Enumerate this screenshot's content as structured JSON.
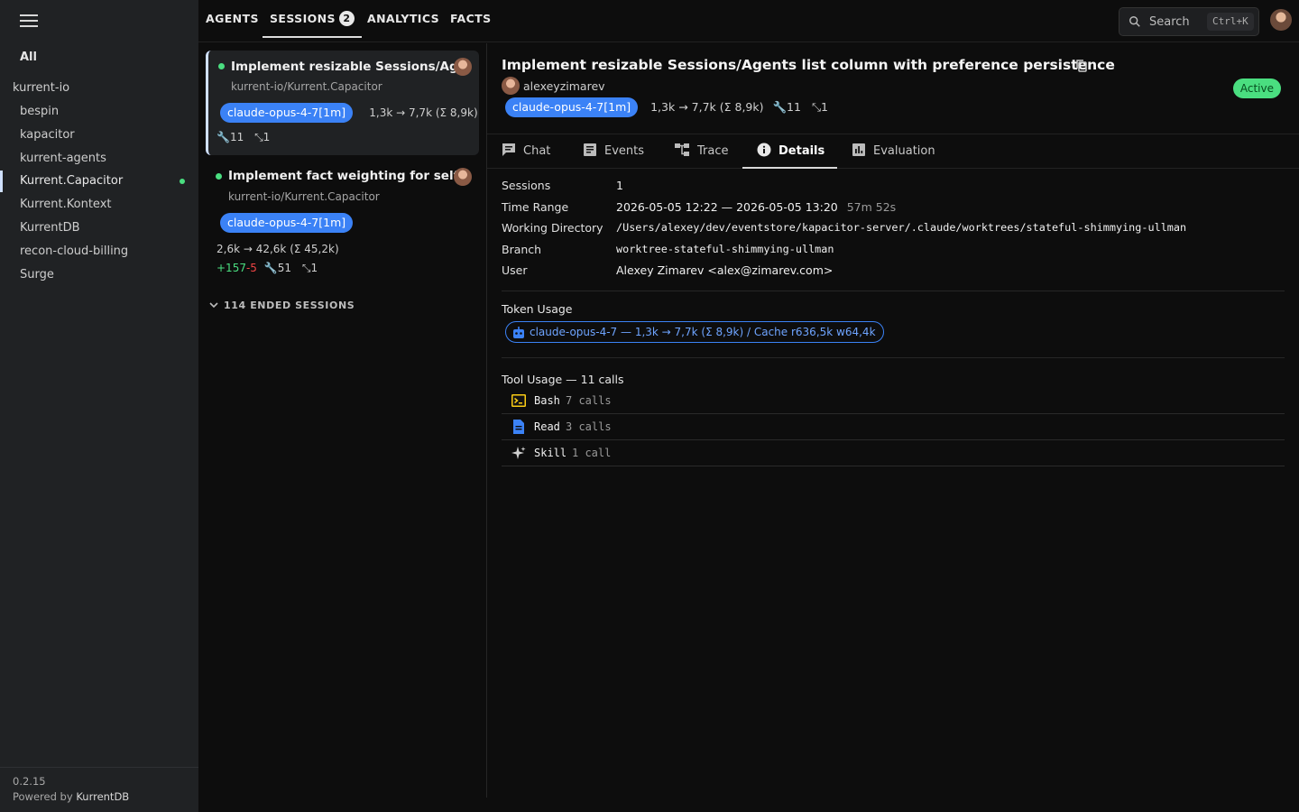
{
  "sidebar": {
    "all_label": "All",
    "group": "kurrent-io",
    "items": [
      {
        "label": "bespin"
      },
      {
        "label": "kapacitor"
      },
      {
        "label": "kurrent-agents"
      },
      {
        "label": "Kurrent.Capacitor"
      },
      {
        "label": "Kurrent.Kontext"
      },
      {
        "label": "KurrentDB"
      },
      {
        "label": "recon-cloud-billing"
      },
      {
        "label": "Surge"
      }
    ],
    "active_item": "Kurrent.Capacitor",
    "version": "0.2.15",
    "powered_prefix": "Powered by",
    "powered_brand": "KurrentDB"
  },
  "topnav": {
    "tabs": {
      "agents": "AGENTS",
      "sessions": "SESSIONS",
      "analytics": "ANALYTICS",
      "facts": "FACTS"
    },
    "sessions_badge": "2",
    "active_tab": "SESSIONS",
    "search_label": "Search",
    "search_shortcut": "Ctrl+K"
  },
  "sessions": [
    {
      "title": "Implement resizable Sessions/Ag...",
      "repo": "kurrent-io/Kurrent.Capacitor",
      "model": "claude-opus-4-7[1m]",
      "tokens": "1,3k → 7,7k (Σ 8,9k)",
      "tools": "11",
      "subagents": "1"
    },
    {
      "title": "Implement fact weighting for self...",
      "repo": "kurrent-io/Kurrent.Capacitor",
      "model": "claude-opus-4-7[1m]",
      "tokens": "2,6k → 42,6k (Σ 45,2k)",
      "added": "+157",
      "removed": "-5",
      "tools": "51",
      "subagents": "1"
    }
  ],
  "ended_label": "114 ENDED SESSIONS",
  "detail": {
    "title": "Implement resizable Sessions/Agents list column with preference persistence",
    "user": "alexeyzimarev",
    "model": "claude-opus-4-7[1m]",
    "tokens": "1,3k → 7,7k (Σ 8,9k)",
    "tools": "11",
    "subagents": "1",
    "status": "Active",
    "tabs": {
      "chat": "Chat",
      "events": "Events",
      "trace": "Trace",
      "details": "Details",
      "evaluation": "Evaluation"
    },
    "active_tab": "Details",
    "fields": {
      "sessions_k": "Sessions",
      "sessions_v": "1",
      "time_k": "Time Range",
      "time_v": "2026-05-05 12:22 — 2026-05-05 13:20",
      "time_dur": "57m 52s",
      "wd_k": "Working Directory",
      "wd_v": "/Users/alexey/dev/eventstore/kapacitor-server/.claude/worktrees/stateful-shimmying-ullman",
      "branch_k": "Branch",
      "branch_v": "worktree-stateful-shimmying-ullman",
      "user_k": "User",
      "user_v": "Alexey Zimarev <alex@zimarev.com>"
    },
    "token_usage_label": "Token Usage",
    "token_usage": "claude-opus-4-7 — 1,3k → 7,7k (Σ 8,9k) / Cache r636,5k w64,4k",
    "tool_usage_label": "Tool Usage — 11 calls",
    "tool_usage": [
      {
        "name": "Bash",
        "calls": "7 calls",
        "icon": "terminal-icon"
      },
      {
        "name": "Read",
        "calls": "3 calls",
        "icon": "file-icon"
      },
      {
        "name": "Skill",
        "calls": "1 call",
        "icon": "sparkle-icon"
      }
    ]
  },
  "colors": {
    "accent_blue": "#3b82f6",
    "status_green": "#4ade80",
    "sidebar_bg": "#202224",
    "page_bg": "#0d0d0d"
  }
}
